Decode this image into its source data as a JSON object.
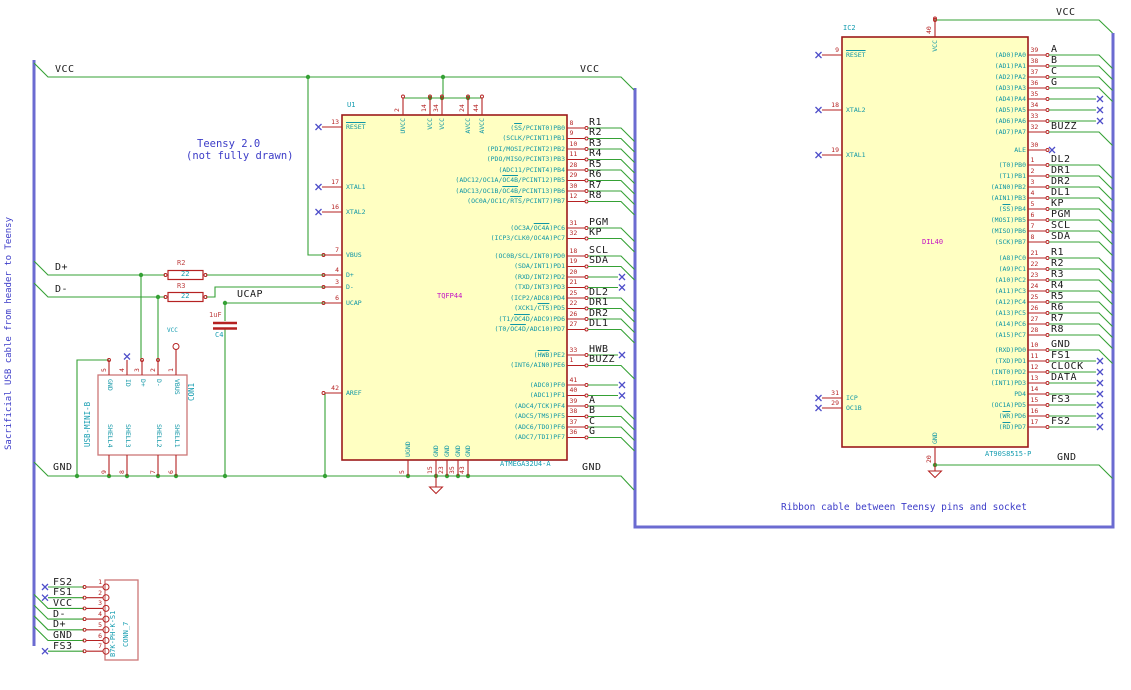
{
  "colors": {
    "wire": "#35a135",
    "bus": "#6b6bd1",
    "pin": "#b52222",
    "ic_border": "#9c1a1a",
    "ic_fill": "#ffffc2",
    "pin_name": "#0f96a6",
    "field": "#149cb0",
    "nc": "#4e4ec9",
    "label": "#1a1a1a",
    "comment": "#3c3cc8",
    "magenta": "#c413c4",
    "conn_border": "#cc7777"
  },
  "comments": {
    "left_vertical": "Sacrificial USB cable from header to Teensy",
    "teensy_line1": "Teensy 2.0",
    "teensy_line2": "(not fully drawn)",
    "ribbon": "Ribbon cable between Teensy pins and socket"
  },
  "net_labels": {
    "vcc_left": "VCC",
    "vcc_mid": "VCC",
    "vcc_right": "VCC",
    "gnd_left": "GND",
    "gnd_mid": "GND",
    "gnd_right": "GND",
    "dplus": "D+",
    "dminus": "D-",
    "ucap": "UCAP",
    "usb_vcc": "VCC"
  },
  "resistors": [
    {
      "ref": "R2",
      "value": "22"
    },
    {
      "ref": "R3",
      "value": "22"
    }
  ],
  "capacitor": {
    "ref": "C4",
    "value": "1uF"
  },
  "u1": {
    "ref": "U1",
    "value": "ATMEGA32U4-A",
    "package": "TQFP44",
    "left_pins": [
      {
        "num": "13",
        "name": "~RESET~",
        "conn": "nc"
      },
      {
        "num": "17",
        "name": "XTAL1",
        "conn": "nc"
      },
      {
        "num": "16",
        "name": "XTAL2",
        "conn": "nc"
      },
      {
        "num": "7",
        "name": "VBUS",
        "conn": "wire"
      },
      {
        "num": "4",
        "name": "D+",
        "conn": "wire"
      },
      {
        "num": "3",
        "name": "D-",
        "conn": "wire"
      },
      {
        "num": "6",
        "name": "UCAP",
        "conn": "wire"
      },
      {
        "num": "42",
        "name": "AREF",
        "conn": "wire"
      }
    ],
    "top_pins": [
      {
        "num": "2",
        "name": "UVCC"
      },
      {
        "num": "14",
        "name": "VCC"
      },
      {
        "num": "34",
        "name": "VCC"
      },
      {
        "num": "24",
        "name": "AVCC"
      },
      {
        "num": "44",
        "name": "AVCC"
      }
    ],
    "bottom_pins": [
      {
        "num": "5",
        "name": "UGND"
      },
      {
        "num": "15",
        "name": "GND"
      },
      {
        "num": "23",
        "name": "GND"
      },
      {
        "num": "35",
        "name": "GND"
      },
      {
        "num": "43",
        "name": "GND"
      }
    ],
    "right_pins": [
      {
        "num": "8",
        "name": "(~SS~/PCINT0)PB0",
        "label": "R1",
        "conn": "bus"
      },
      {
        "num": "9",
        "name": "(SCLK/PCINT1)PB1",
        "label": "R2",
        "conn": "bus"
      },
      {
        "num": "10",
        "name": "(PDI/MOSI/PCINT2)PB2",
        "label": "R3",
        "conn": "bus"
      },
      {
        "num": "11",
        "name": "(PDO/MISO/PCINT3)PB3",
        "label": "R4",
        "conn": "bus"
      },
      {
        "num": "28",
        "name": "(ADC11/PCINT4)PB4",
        "label": "R5",
        "conn": "bus"
      },
      {
        "num": "29",
        "name": "(ADC12/OC1A/~OC4B~/PCINT12)PB5",
        "label": "R6",
        "conn": "bus"
      },
      {
        "num": "30",
        "name": "(ADC13/OC1B/~OC4B~/PCINT13)PB6",
        "label": "R7",
        "conn": "bus"
      },
      {
        "num": "12",
        "name": "(OC0A/OC1C/~RTS~/PCINT7)PB7",
        "label": "R8",
        "conn": "bus"
      },
      {
        "num": "31",
        "name": "(OC3A/~OC4A~)PC6",
        "label": "PGM",
        "conn": "bus"
      },
      {
        "num": "32",
        "name": "(ICP3/CLK0/OC4A)PC7",
        "label": "KP",
        "conn": "bus"
      },
      {
        "num": "18",
        "name": "(OC0B/SCL/INT0)PD0",
        "label": "SCL",
        "conn": "bus"
      },
      {
        "num": "19",
        "name": "(SDA/INT1)PD1",
        "label": "SDA",
        "conn": "bus"
      },
      {
        "num": "20",
        "name": "(RXD/INT2)PD2",
        "label": "",
        "conn": "nc"
      },
      {
        "num": "21",
        "name": "(TXD/INT3)PD3",
        "label": "",
        "conn": "nc"
      },
      {
        "num": "25",
        "name": "(ICP2/ADC8)PD4",
        "label": "DL2",
        "conn": "bus"
      },
      {
        "num": "22",
        "name": "(XCK1/~CTS~)PD5",
        "label": "DR1",
        "conn": "bus"
      },
      {
        "num": "26",
        "name": "(T1/~OC4D~/ADC9)PD6",
        "label": "DR2",
        "conn": "bus"
      },
      {
        "num": "27",
        "name": "(T0/~OC4D~/ADC10)PD7",
        "label": "DL1",
        "conn": "bus"
      },
      {
        "num": "33",
        "name": "(~HWB~)PE2",
        "label": "HWB",
        "conn": "nc"
      },
      {
        "num": "1",
        "name": "(INT6/AIN0)PE6",
        "label": "BUZZ",
        "conn": "bus"
      },
      {
        "num": "41",
        "name": "(ADC0)PF0",
        "label": "",
        "conn": "nc"
      },
      {
        "num": "40",
        "name": "(ADC1)PF1",
        "label": "",
        "conn": "nc"
      },
      {
        "num": "39",
        "name": "(ADC4/TCK)PF4",
        "label": "A",
        "conn": "bus"
      },
      {
        "num": "38",
        "name": "(ADC5/TMS)PF5",
        "label": "B",
        "conn": "bus"
      },
      {
        "num": "37",
        "name": "(ADC6/TDO)PF6",
        "label": "C",
        "conn": "bus"
      },
      {
        "num": "36",
        "name": "(ADC7/TDI)PF7",
        "label": "G",
        "conn": "bus"
      }
    ]
  },
  "ic2": {
    "ref": "IC2",
    "value": "AT90S8515-P",
    "package": "DIL40",
    "left_pins": [
      {
        "num": "9",
        "name": "~RESET~"
      },
      {
        "num": "18",
        "name": "XTAL2"
      },
      {
        "num": "19",
        "name": "XTAL1"
      },
      {
        "num": "31",
        "name": "ICP"
      },
      {
        "num": "29",
        "name": "OC1B"
      }
    ],
    "top_pins": [
      {
        "num": "40",
        "name": "VCC"
      }
    ],
    "bottom_pins": [
      {
        "num": "20",
        "name": "GND"
      }
    ],
    "right_pins": [
      {
        "num": "39",
        "name": "(AD0)PA0",
        "label": "A",
        "conn": "bus"
      },
      {
        "num": "38",
        "name": "(AD1)PA1",
        "label": "B",
        "conn": "bus"
      },
      {
        "num": "37",
        "name": "(AD2)PA2",
        "label": "C",
        "conn": "bus"
      },
      {
        "num": "36",
        "name": "(AD3)PA3",
        "label": "G",
        "conn": "bus"
      },
      {
        "num": "35",
        "name": "(AD4)PA4",
        "label": "",
        "conn": "nc"
      },
      {
        "num": "34",
        "name": "(AD5)PA5",
        "label": "",
        "conn": "nc"
      },
      {
        "num": "33",
        "name": "(AD6)PA6",
        "label": "",
        "conn": "nc"
      },
      {
        "num": "32",
        "name": "(AD7)PA7",
        "label": "BUZZ",
        "conn": "bus"
      },
      {
        "num": "30",
        "name": "ALE",
        "label": "",
        "conn": "nc_short"
      },
      {
        "num": "1",
        "name": "(T0)PB0",
        "label": "DL2",
        "conn": "bus"
      },
      {
        "num": "2",
        "name": "(T1)PB1",
        "label": "DR1",
        "conn": "bus"
      },
      {
        "num": "3",
        "name": "(AIN0)PB2",
        "label": "DR2",
        "conn": "bus"
      },
      {
        "num": "4",
        "name": "(AIN1)PB3",
        "label": "DL1",
        "conn": "bus"
      },
      {
        "num": "5",
        "name": "(~SS~)PB4",
        "label": "KP",
        "conn": "bus"
      },
      {
        "num": "6",
        "name": "(MOSI)PB5",
        "label": "PGM",
        "conn": "bus"
      },
      {
        "num": "7",
        "name": "(MISO)PB6",
        "label": "SCL",
        "conn": "bus"
      },
      {
        "num": "8",
        "name": "(SCK)PB7",
        "label": "SDA",
        "conn": "bus"
      },
      {
        "num": "21",
        "name": "(A8)PC0",
        "label": "R1",
        "conn": "bus"
      },
      {
        "num": "22",
        "name": "(A9)PC1",
        "label": "R2",
        "conn": "bus"
      },
      {
        "num": "23",
        "name": "(A10)PC2",
        "label": "R3",
        "conn": "bus"
      },
      {
        "num": "24",
        "name": "(A11)PC3",
        "label": "R4",
        "conn": "bus"
      },
      {
        "num": "25",
        "name": "(A12)PC4",
        "label": "R5",
        "conn": "bus"
      },
      {
        "num": "26",
        "name": "(A13)PC5",
        "label": "R6",
        "conn": "bus"
      },
      {
        "num": "27",
        "name": "(A14)PC6",
        "label": "R7",
        "conn": "bus"
      },
      {
        "num": "28",
        "name": "(A15)PC7",
        "label": "R8",
        "conn": "bus"
      },
      {
        "num": "10",
        "name": "(RXD)PD0",
        "label": "GND",
        "conn": "bus"
      },
      {
        "num": "11",
        "name": "(TXD)PD1",
        "label": "FS1",
        "conn": "nc"
      },
      {
        "num": "12",
        "name": "(INT0)PD2",
        "label": "CLOCK",
        "conn": "nc"
      },
      {
        "num": "13",
        "name": "(INT1)PD3",
        "label": "DATA",
        "conn": "nc"
      },
      {
        "num": "14",
        "name": "PD4",
        "label": "",
        "conn": "nc"
      },
      {
        "num": "15",
        "name": "(OC1A)PD5",
        "label": "FS3",
        "conn": "nc"
      },
      {
        "num": "16",
        "name": "(~WR~)PD6",
        "label": "",
        "conn": "nc"
      },
      {
        "num": "17",
        "name": "(~RD~)PD7",
        "label": "FS2",
        "conn": "nc"
      }
    ]
  },
  "con1": {
    "ref": "CON1",
    "value": "USB-MINI-B",
    "top_pins": [
      {
        "num": "5",
        "name": "GND"
      },
      {
        "num": "4",
        "name": "ID"
      },
      {
        "num": "3",
        "name": "D+"
      },
      {
        "num": "2",
        "name": "D-"
      },
      {
        "num": "1",
        "name": "VBUS"
      }
    ],
    "bottom_pins": [
      {
        "num": "9",
        "name": "SHELL4"
      },
      {
        "num": "8",
        "name": "SHELL3"
      },
      {
        "num": "7",
        "name": "SHELL2"
      },
      {
        "num": "6",
        "name": "SHELL1"
      }
    ]
  },
  "conn7": {
    "ref": "CONN_7",
    "value": "B7K-PH-K-S1",
    "pins": [
      {
        "num": "1",
        "label": "FS2",
        "conn": "nc"
      },
      {
        "num": "2",
        "label": "FS1",
        "conn": "nc"
      },
      {
        "num": "3",
        "label": "VCC",
        "conn": "bus"
      },
      {
        "num": "4",
        "label": "D-",
        "conn": "bus"
      },
      {
        "num": "5",
        "label": "D+",
        "conn": "bus"
      },
      {
        "num": "6",
        "label": "GND",
        "conn": "bus"
      },
      {
        "num": "7",
        "label": "FS3",
        "conn": "nc"
      }
    ]
  }
}
